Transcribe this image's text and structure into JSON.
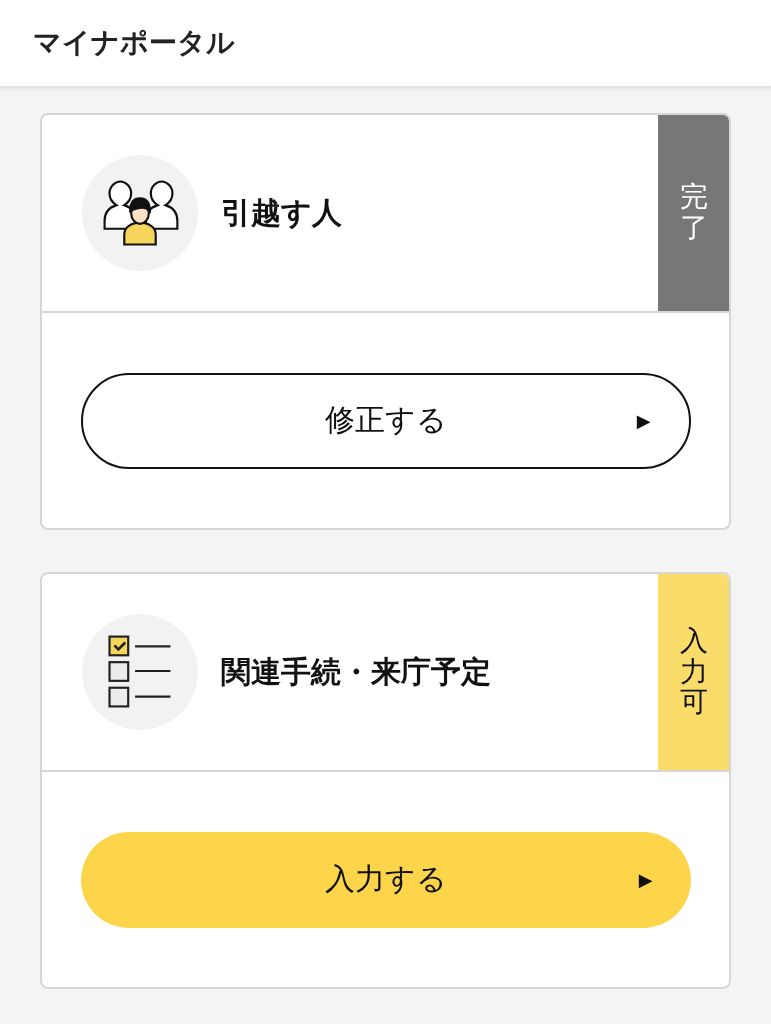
{
  "header": {
    "title": "マイナポータル"
  },
  "cards": [
    {
      "kind": "people",
      "title": "引越す人",
      "status": {
        "label": "完了",
        "color": "#777777"
      },
      "button": {
        "label": "修正する",
        "arrow": "▶",
        "kind": "outline"
      }
    },
    {
      "kind": "checklist",
      "title": "関連手続・来庁予定",
      "status": {
        "label": "入力可",
        "color": "#f9dc6a"
      },
      "button": {
        "label": "入力する",
        "arrow": "▶",
        "kind": "primary"
      }
    }
  ]
}
